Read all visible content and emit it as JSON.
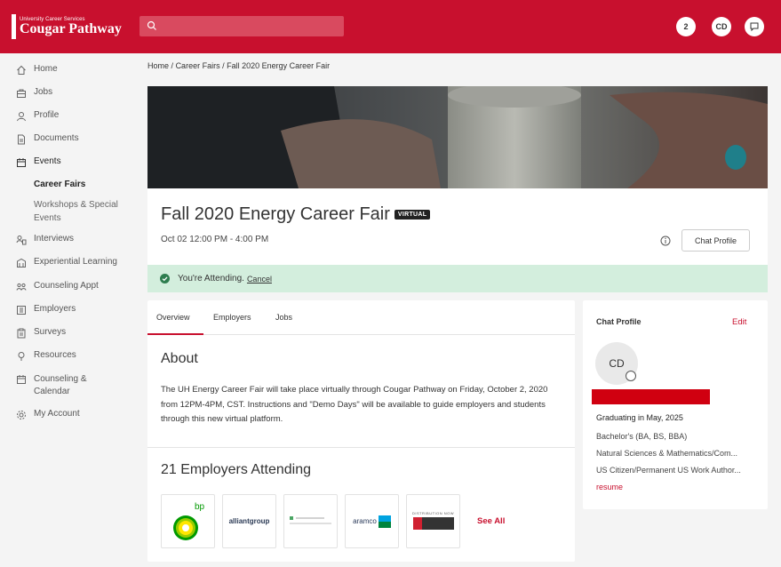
{
  "header": {
    "logo_small": "University Career Services",
    "logo_big": "Cougar Pathway",
    "search_placeholder": "",
    "notif_count": "2",
    "user_initials": "CD"
  },
  "sidebar": {
    "items": [
      {
        "label": "Home",
        "icon": "home-icon"
      },
      {
        "label": "Jobs",
        "icon": "briefcase-icon"
      },
      {
        "label": "Profile",
        "icon": "person-icon"
      },
      {
        "label": "Documents",
        "icon": "document-icon"
      },
      {
        "label": "Events",
        "icon": "calendar-icon"
      },
      {
        "label": "Career Fairs"
      },
      {
        "label": "Workshops & Special Events"
      },
      {
        "label": "Interviews",
        "icon": "interview-icon"
      },
      {
        "label": "Experiential Learning",
        "icon": "building-icon"
      },
      {
        "label": "Counseling Appt",
        "icon": "people-icon"
      },
      {
        "label": "Employers",
        "icon": "employers-icon"
      },
      {
        "label": "Surveys",
        "icon": "clipboard-icon"
      },
      {
        "label": "Resources",
        "icon": "bulb-icon"
      },
      {
        "label": "Counseling & Calendar",
        "icon": "calendar-icon"
      },
      {
        "label": "My Account",
        "icon": "gear-icon"
      }
    ]
  },
  "breadcrumb": {
    "home": "Home",
    "sep": "/",
    "career_fairs": "Career Fairs",
    "current": "Fall 2020 Energy Career Fair"
  },
  "event": {
    "title": "Fall 2020 Energy Career Fair",
    "badge": "VIRTUAL",
    "date": "Oct 02 12:00 PM - 4:00 PM",
    "chat_button": "Chat Profile",
    "attending_text": "You're Attending.",
    "cancel_label": "Cancel"
  },
  "tabs": [
    "Overview",
    "Employers",
    "Jobs"
  ],
  "about": {
    "title": "About",
    "text": "The UH Energy Career Fair will take place virtually through Cougar Pathway on Friday, October 2, 2020 from 12PM-4PM, CST. Instructions and \"Demo Days\" will be available to guide employers and students through this new virtual platform."
  },
  "employers": {
    "title": "21 Employers Attending",
    "logos": [
      "bp",
      "alliantgroup",
      "",
      "aramco",
      "DISTRIBUTION NOW"
    ],
    "see_all": "See All"
  },
  "profile": {
    "title": "Chat Profile",
    "edit": "Edit",
    "initials": "CD",
    "graduating": "Graduating in May, 2025",
    "degree": "Bachelor's (BA, BS, BBA)",
    "college": "Natural Sciences & Mathematics/Com...",
    "work_auth": "US Citizen/Permanent US Work Author...",
    "resume": "resume"
  },
  "colors": {
    "brand": "#c8102e",
    "attending_bg": "#d3eedd",
    "attending_check": "#2e7d4f"
  }
}
